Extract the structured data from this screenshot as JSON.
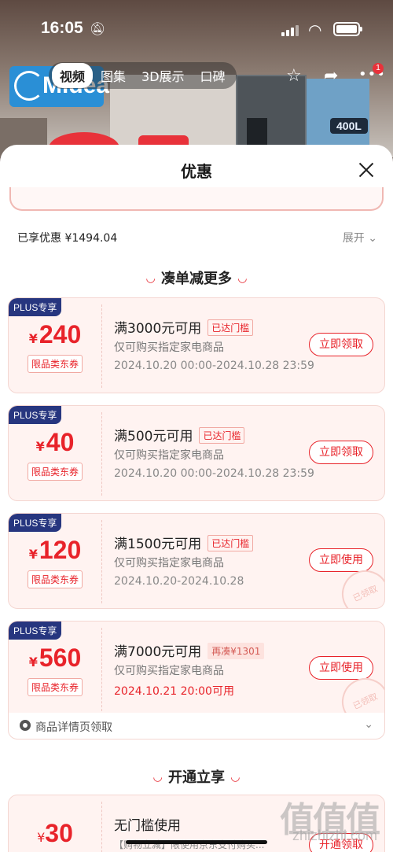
{
  "status_bar": {
    "time": "16:05"
  },
  "background": {
    "size_tag": "400L",
    "brand": "Midea"
  },
  "media_tabs": [
    {
      "label": "视频"
    },
    {
      "label": "图集"
    },
    {
      "label": "3D展示"
    },
    {
      "label": "口碑"
    }
  ],
  "notification_count": "1",
  "sheet": {
    "title": "优惠",
    "discount_label": "已享优惠 ¥1494.04",
    "expand_label": "展开",
    "section1_title": "凑单减更多",
    "section2_title": "开通立享",
    "source_text": "商品详情页领取"
  },
  "coupons": [
    {
      "badge": "PLUS专享",
      "yen": "¥",
      "amount": "240",
      "type": "限品类东券",
      "condition": "满3000元可用",
      "status": "已达门槛",
      "desc": "仅可购买指定家电商品",
      "date": "2024.10.20 00:00-2024.10.28 23:59",
      "action": "立即领取"
    },
    {
      "badge": "PLUS专享",
      "yen": "¥",
      "amount": "40",
      "type": "限品类东券",
      "condition": "满500元可用",
      "status": "已达门槛",
      "desc": "仅可购买指定家电商品",
      "date": "2024.10.20 00:00-2024.10.28 23:59",
      "action": "立即领取"
    },
    {
      "badge": "PLUS专享",
      "yen": "¥",
      "amount": "120",
      "type": "限品类东券",
      "condition": "满1500元可用",
      "status": "已达门槛",
      "desc": "仅可购买指定家电商品",
      "date": "2024.10.20-2024.10.28",
      "action": "立即使用",
      "stamp": "已领取"
    },
    {
      "badge": "PLUS专享",
      "yen": "¥",
      "amount": "560",
      "type": "限品类东券",
      "condition": "满7000元可用",
      "status": "再凑¥1301",
      "desc": "仅可购买指定家电商品",
      "date": "2024.10.21 20:00可用",
      "action": "立即使用",
      "stamp": "已领取"
    }
  ],
  "bottom_coupon": {
    "yen": "¥",
    "amount": "30",
    "condition": "无门槛使用",
    "desc": "【购物立减】限使用京东支付购买...",
    "action": "开通领取"
  },
  "watermark": {
    "text": "值值值",
    "url": "zhizhizhi.com"
  },
  "colors": {
    "accent": "#e8232a",
    "plus_badge": "#27367f",
    "coupon_bg": "#fff3f1"
  },
  "icons": {
    "mute": "bell-slash-icon",
    "star": "star-icon",
    "share": "share-icon",
    "more": "more-icon",
    "close": "close-icon"
  }
}
